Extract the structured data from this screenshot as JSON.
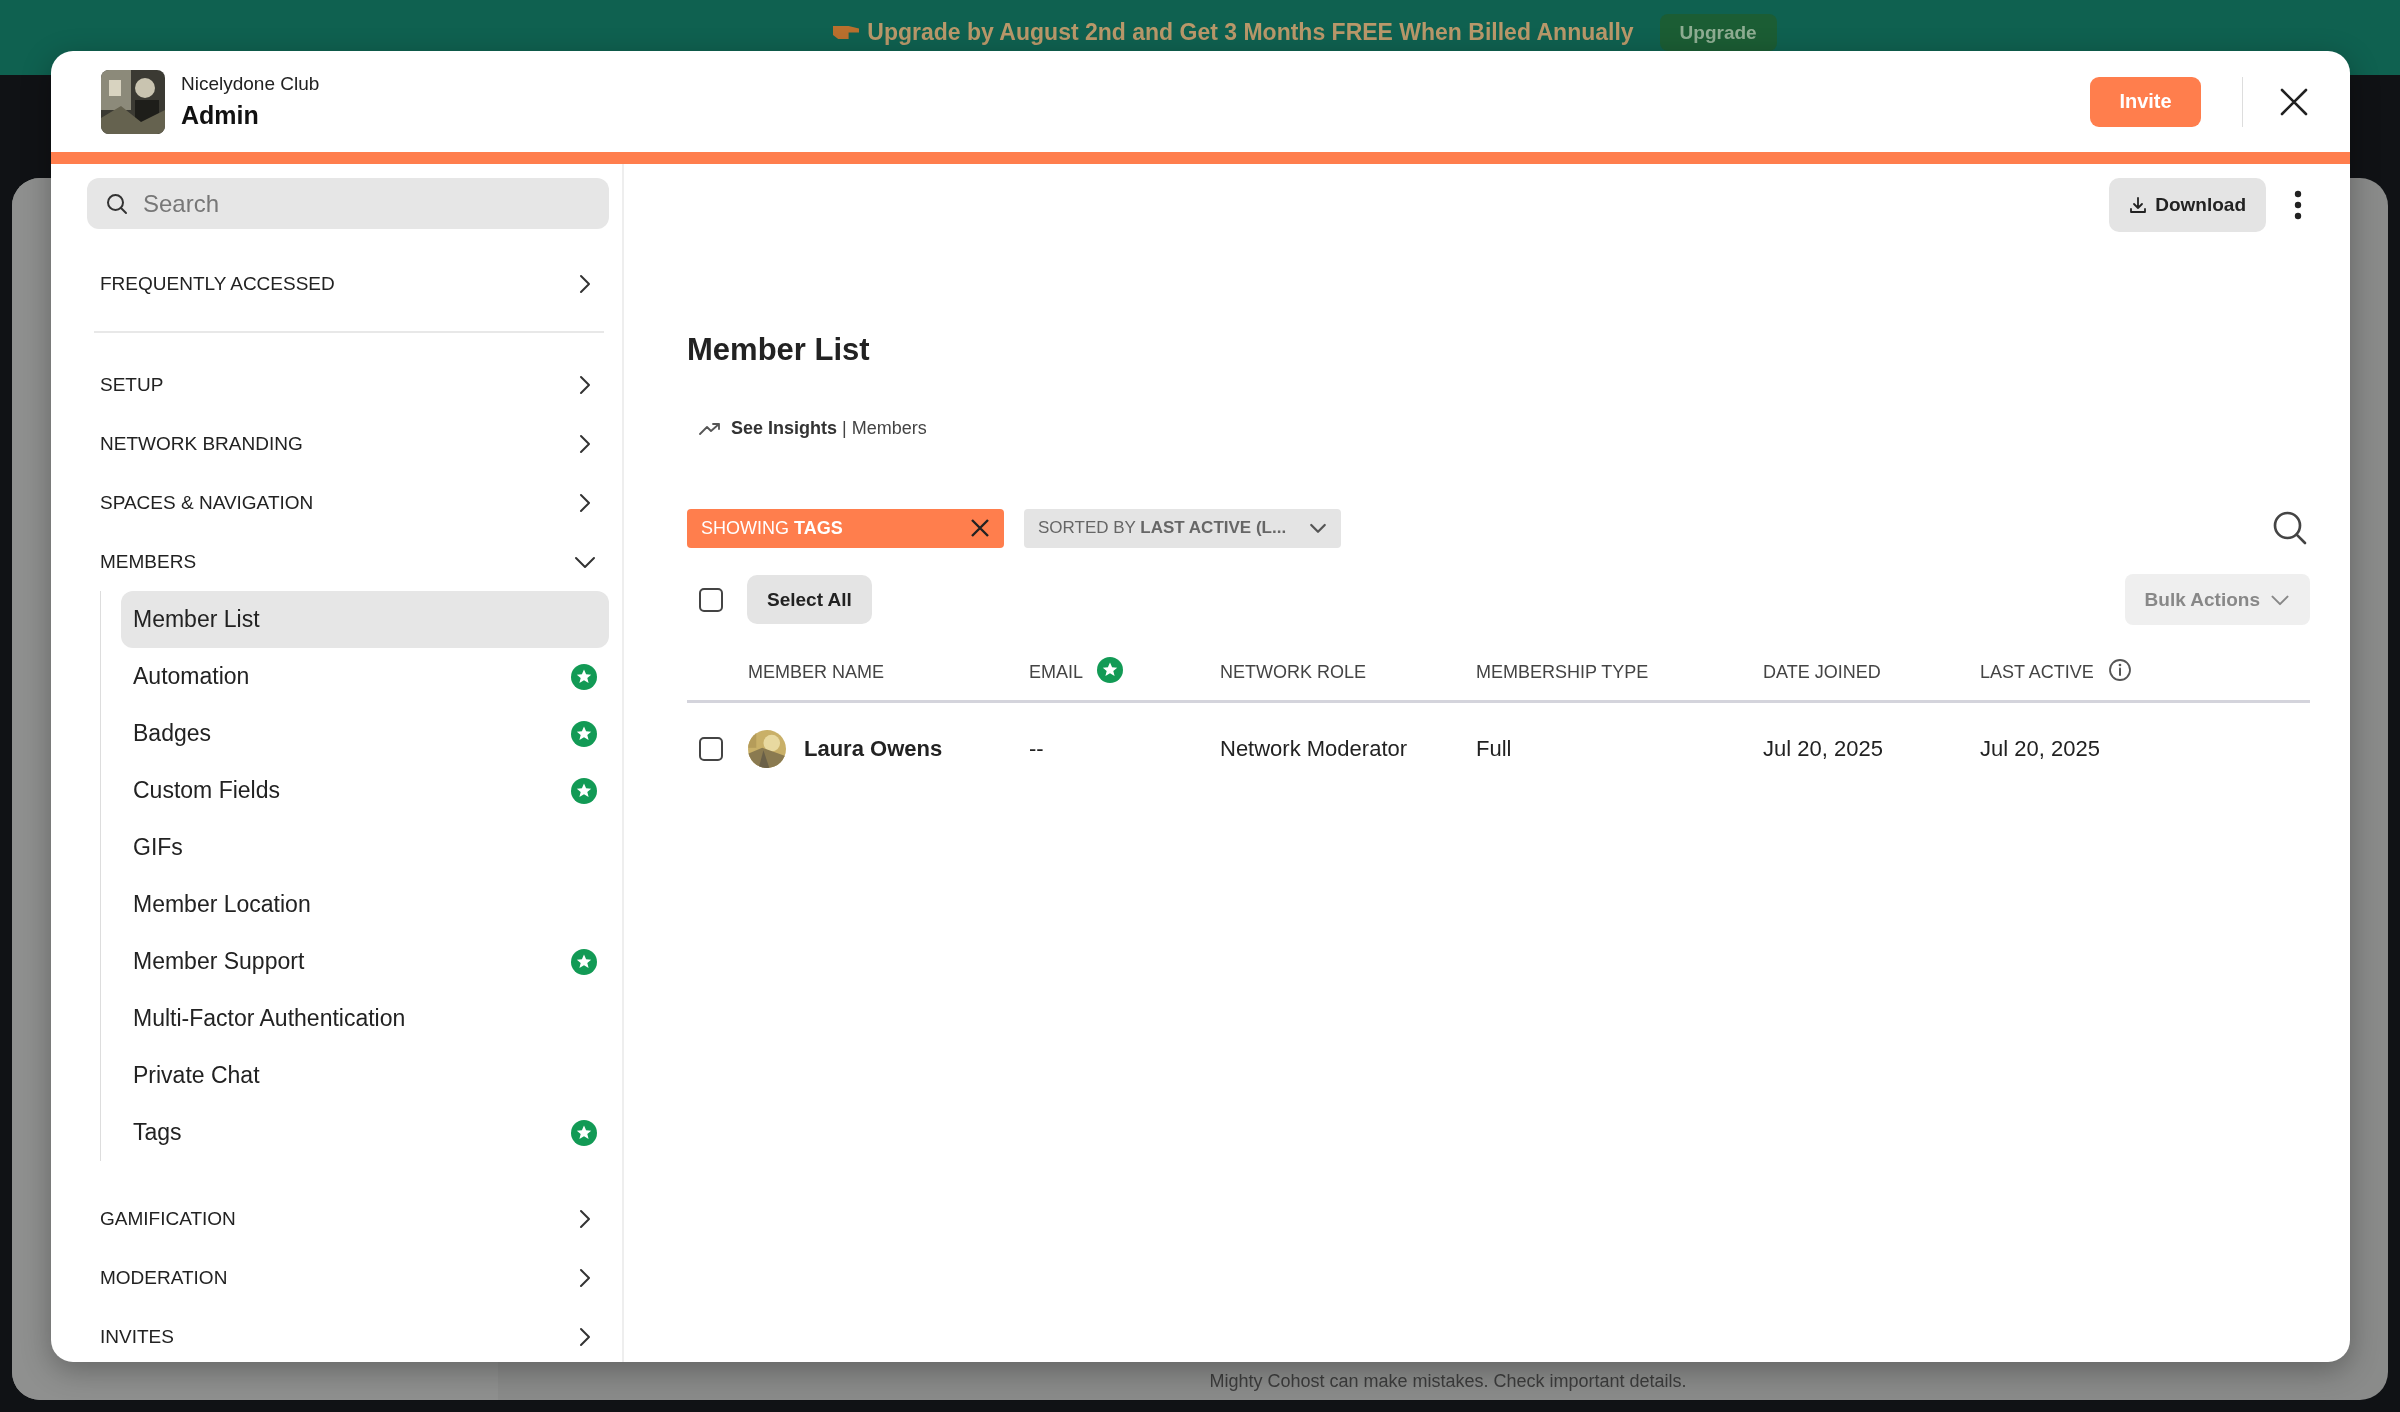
{
  "banner": {
    "text": "Upgrade by August 2nd and Get 3 Months FREE When Billed Annually",
    "button": "Upgrade"
  },
  "header": {
    "club": "Nicelydone Club",
    "title": "Admin",
    "invite": "Invite"
  },
  "sidebar": {
    "search": {
      "placeholder": "Search"
    },
    "frequently_accessed": {
      "label": "FREQUENTLY ACCESSED",
      "expanded": false
    },
    "sections": [
      {
        "label": "SETUP",
        "expanded": false
      },
      {
        "label": "NETWORK BRANDING",
        "expanded": false
      },
      {
        "label": "SPACES & NAVIGATION",
        "expanded": false
      },
      {
        "label": "MEMBERS",
        "expanded": true,
        "children": [
          {
            "label": "Member List",
            "selected": true,
            "premium": false
          },
          {
            "label": "Automation",
            "selected": false,
            "premium": true
          },
          {
            "label": "Badges",
            "selected": false,
            "premium": true
          },
          {
            "label": "Custom Fields",
            "selected": false,
            "premium": true
          },
          {
            "label": "GIFs",
            "selected": false,
            "premium": false
          },
          {
            "label": "Member Location",
            "selected": false,
            "premium": false
          },
          {
            "label": "Member Support",
            "selected": false,
            "premium": true
          },
          {
            "label": "Multi-Factor Authentication",
            "selected": false,
            "premium": false
          },
          {
            "label": "Private Chat",
            "selected": false,
            "premium": false
          },
          {
            "label": "Tags",
            "selected": false,
            "premium": true
          }
        ]
      },
      {
        "label": "GAMIFICATION",
        "expanded": false
      },
      {
        "label": "MODERATION",
        "expanded": false
      },
      {
        "label": "INVITES",
        "expanded": false
      }
    ]
  },
  "main": {
    "download": "Download",
    "title": "Member List",
    "insights": {
      "link": "See Insights",
      "text": "| Members"
    },
    "filters": [
      {
        "kind": "tag",
        "text": "SHOWING **TAGS**"
      },
      {
        "kind": "sort",
        "text": "SORTED BY **LAST ACTIVE (L...**"
      }
    ],
    "select_all": {
      "label": "Select All",
      "checked": false
    },
    "bulk_actions": {
      "label": "Bulk Actions",
      "disabled": true
    },
    "columns": [
      {
        "label": "MEMBER NAME",
        "premium": false,
        "info": false
      },
      {
        "label": "EMAIL",
        "premium": true,
        "info": false
      },
      {
        "label": "NETWORK ROLE",
        "premium": false,
        "info": false
      },
      {
        "label": "MEMBERSHIP TYPE",
        "premium": false,
        "info": false
      },
      {
        "label": "DATE JOINED",
        "premium": false,
        "info": false
      },
      {
        "label": "LAST ACTIVE",
        "premium": false,
        "info": true
      }
    ],
    "rows": [
      {
        "checked": false,
        "name": "Laura Owens",
        "email": "--",
        "role": "Network Moderator",
        "membership": "Full",
        "joined": "Jul 20, 2025",
        "last_active": "Jul 20, 2025"
      }
    ]
  },
  "footer_note": "Mighty Cohost can make mistakes. Check important details."
}
